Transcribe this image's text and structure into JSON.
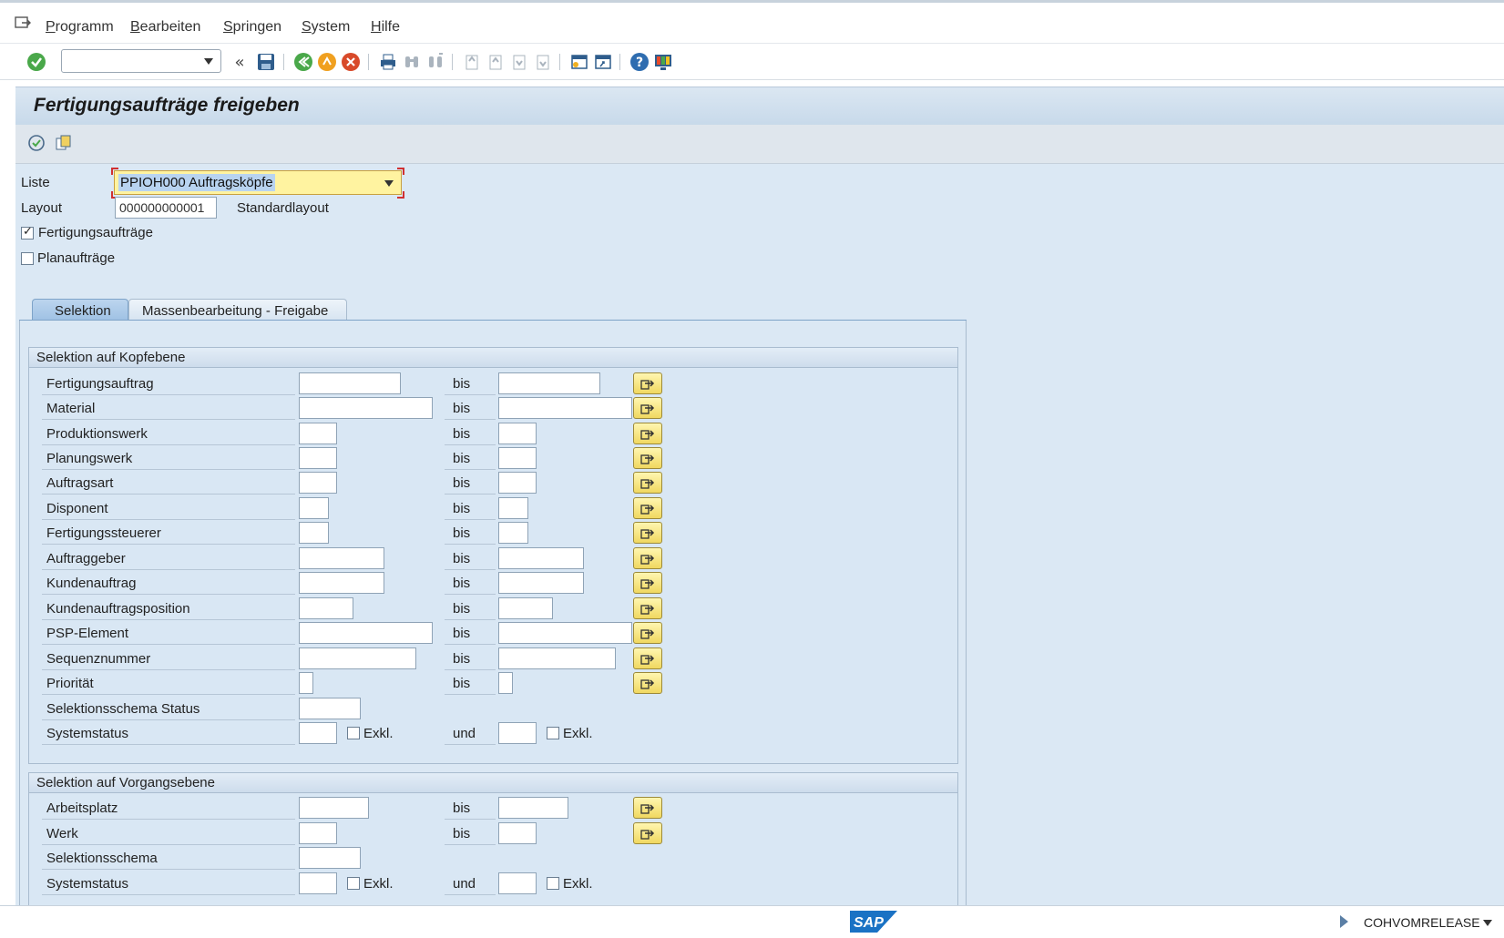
{
  "menu": {
    "items": [
      "Programm",
      "Bearbeiten",
      "Springen",
      "System",
      "Hilfe"
    ]
  },
  "page": {
    "title": "Fertigungsaufträge freigeben"
  },
  "form": {
    "liste_label": "Liste",
    "liste_value": "PPIOH000 Auftragsköpfe",
    "layout_label": "Layout",
    "layout_value": "000000000001",
    "layout_text": "Standardlayout",
    "fertigungsauftraege_label": "Fertigungsaufträge",
    "planauftraege_label": "Planaufträge"
  },
  "tabs": [
    "Selektion",
    "Massenbearbeitung - Freigabe"
  ],
  "kopf": {
    "title": "Selektion auf Kopfebene",
    "rows": [
      "Fertigungsauftrag",
      "Material",
      "Produktionswerk",
      "Planungswerk",
      "Auftragsart",
      "Disponent",
      "Fertigungssteuerer",
      "Auftraggeber",
      "Kundenauftrag",
      "Kundenauftragsposition",
      "PSP-Element",
      "Sequenznummer",
      "Priorität"
    ],
    "schema_label": "Selektionsschema Status",
    "status_label": "Systemstatus"
  },
  "vorgang": {
    "title": "Selektion auf Vorgangsebene",
    "rows": [
      "Arbeitsplatz",
      "Werk"
    ],
    "schema_label": "Selektionsschema",
    "status_label": "Systemstatus"
  },
  "common": {
    "bis": "bis",
    "und": "und",
    "exkl": "Exkl."
  },
  "status": {
    "transaction": "COHVOMRELEASE",
    "logo": "SAP"
  },
  "colors": {
    "accent": "#9fc1e4",
    "panel": "#dbe8f4",
    "highlight": "#fff3a0"
  }
}
